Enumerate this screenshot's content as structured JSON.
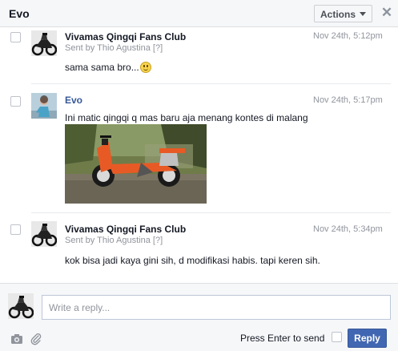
{
  "header": {
    "title": "Evo",
    "actions_label": "Actions",
    "close_label": "✕"
  },
  "messages": [
    {
      "sender": "Vivamas Qingqi Fans Club",
      "sent_by": "Sent by Thio Agustina",
      "help_marker": "[?]",
      "time": "Nov 24th, 5:12pm",
      "text": "sama sama bro...",
      "emoji": "smile-emoji"
    },
    {
      "sender": "Evo",
      "time": "Nov 24th, 5:17pm",
      "text": "Ini matic qingqi q mas baru aja menang kontes di malang",
      "attachment": "photo-orange-scooter"
    },
    {
      "sender": "Vivamas Qingqi Fans Club",
      "sent_by": "Sent by Thio Agustina",
      "help_marker": "[?]",
      "time": "Nov 24th, 5:34pm",
      "text": "kok bisa jadi kaya gini sih, d modifikasi habis. tapi keren sih."
    }
  ],
  "composer": {
    "placeholder": "Write a reply...",
    "press_enter_label": "Press Enter to send",
    "reply_label": "Reply",
    "icons": [
      "camera-icon",
      "paperclip-icon"
    ]
  },
  "colors": {
    "link_blue": "#365899",
    "button_blue": "#4267b2",
    "meta_gray": "#90949c"
  }
}
